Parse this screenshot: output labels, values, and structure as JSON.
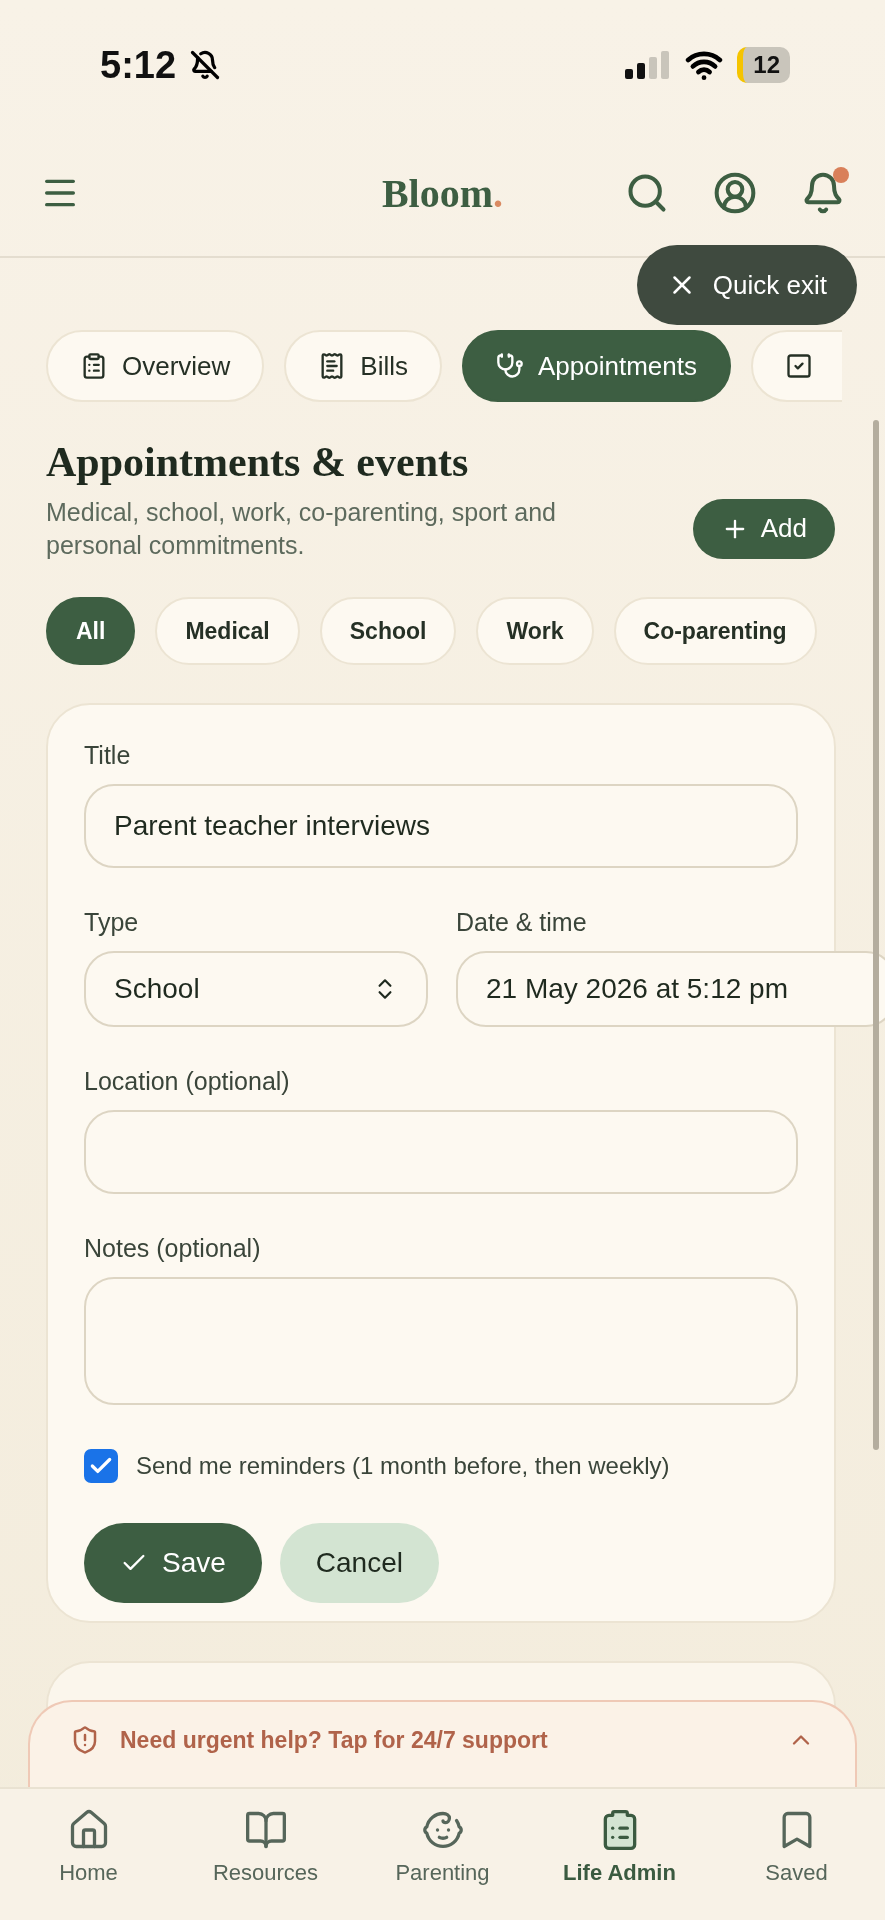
{
  "status_bar": {
    "time": "5:12",
    "battery": "12"
  },
  "header": {
    "logo": "Bloom",
    "logo_dot": ".",
    "notification_badge": true
  },
  "quick_exit": {
    "label": "Quick exit"
  },
  "section_tabs": [
    {
      "kind": "labeled",
      "label": "Overview",
      "selected": false
    },
    {
      "kind": "labeled",
      "label": "Bills",
      "selected": false
    },
    {
      "kind": "labeled",
      "label": "Appointments",
      "selected": true
    },
    {
      "kind": "icon_only",
      "selected": false
    }
  ],
  "page": {
    "title": "Appointments & events",
    "subtitle": "Medical, school, work, co-parenting, sport and personal commitments.",
    "add_button": "Add"
  },
  "filters": [
    {
      "label": "All",
      "selected": true
    },
    {
      "label": "Medical",
      "selected": false
    },
    {
      "label": "School",
      "selected": false
    },
    {
      "label": "Work",
      "selected": false
    },
    {
      "label": "Co-parenting",
      "selected": false
    }
  ],
  "form": {
    "title_label": "Title",
    "title_value": "Parent teacher interviews",
    "type_label": "Type",
    "type_value": "School",
    "date_label": "Date & time",
    "date_value": "21 May 2026 at 5:12 pm",
    "location_label": "Location (optional)",
    "notes_label": "Notes (optional)",
    "reminders": {
      "label": "Send me reminders (1 month before, then weekly)",
      "checked": true
    },
    "save": "Save",
    "cancel": "Cancel"
  },
  "urgent_banner": {
    "label": "Need urgent help? Tap for 24/7 support"
  },
  "bottom_nav": [
    {
      "label": "Home",
      "selected": false
    },
    {
      "label": "Resources",
      "selected": false
    },
    {
      "label": "Parenting",
      "selected": false
    },
    {
      "label": "Life Admin",
      "selected": true
    },
    {
      "label": "Saved",
      "selected": false
    }
  ]
}
